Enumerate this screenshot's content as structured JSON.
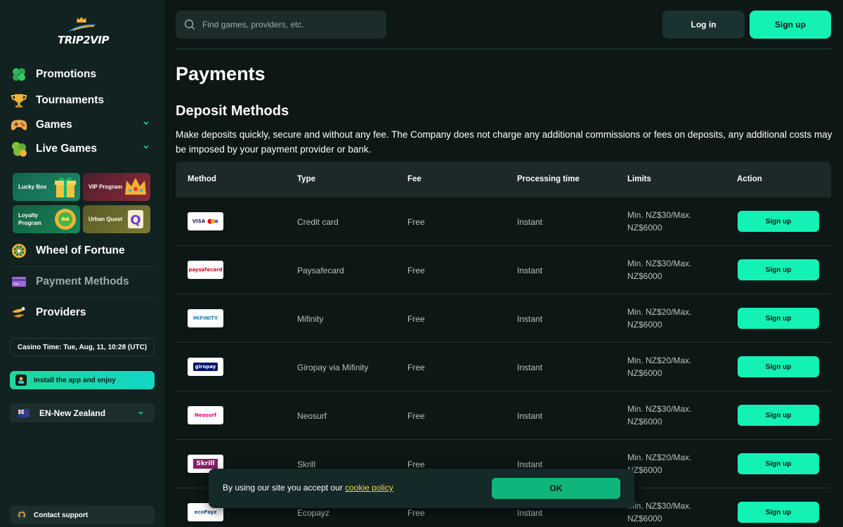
{
  "brand": {
    "logo_text": "TRIP2VIP"
  },
  "sidebar": {
    "nav": [
      {
        "label": "Promotions",
        "icon": "clover-icon"
      },
      {
        "label": "Tournaments",
        "icon": "trophy-icon"
      },
      {
        "label": "Games",
        "icon": "gamepad-icon"
      },
      {
        "label": "Live Games",
        "icon": "clover-live-icon"
      }
    ],
    "promos": [
      {
        "label": "Lucky Box",
        "icon": "gift-box-icon"
      },
      {
        "label": "VIP Program",
        "icon": "crown-icon"
      },
      {
        "label": "Loyalty Program",
        "icon": "loyalty-coin-icon"
      },
      {
        "label": "Urban Quest",
        "icon": "quest-scroll-icon"
      }
    ],
    "wheel": "Wheel of Fortune",
    "payment_methods": "Payment Methods",
    "providers": "Providers",
    "casino_time": "Casino Time: Tue, Aug, 11, 10:28 (UTC)",
    "install": "Install the app and enjoy",
    "language": "EN-New Zealand",
    "support": "Contact support"
  },
  "header": {
    "search_placeholder": "Find games, providers, etc.",
    "login": "Log in",
    "signup": "Sign up"
  },
  "main": {
    "title": "Payments",
    "section_title": "Deposit Methods",
    "description": "Make deposits quickly, secure and without any fee. The Company does not charge any additional commissions or fees on deposits, any additional costs may be imposed by your payment provider or bank.",
    "columns": [
      "Method",
      "Type",
      "Fee",
      "Processing time",
      "Limits",
      "Action"
    ],
    "rows": [
      {
        "logo": "VISA",
        "type": "Credit card",
        "fee": "Free",
        "time": "Instant",
        "limits": "Min. NZ$30/Max. NZ$6000",
        "action": "Sign up"
      },
      {
        "logo": "paysafecard",
        "type": "Paysafecard",
        "fee": "Free",
        "time": "Instant",
        "limits": "Min. NZ$30/Max. NZ$6000",
        "action": "Sign up"
      },
      {
        "logo": "MiFINITY",
        "type": "Mifinity",
        "fee": "Free",
        "time": "Instant",
        "limits": "Min. NZ$20/Max. NZ$6000",
        "action": "Sign up"
      },
      {
        "logo": "giropay",
        "type": "Giropay via Mifinity",
        "fee": "Free",
        "time": "Instant",
        "limits": "Min. NZ$20/Max. NZ$6000",
        "action": "Sign up"
      },
      {
        "logo": "Neosurf",
        "type": "Neosurf",
        "fee": "Free",
        "time": "Instant",
        "limits": "Min. NZ$30/Max. NZ$6000",
        "action": "Sign up"
      },
      {
        "logo": "Skrill",
        "type": "Skrill",
        "fee": "Free",
        "time": "Instant",
        "limits": "Min. NZ$20/Max. NZ$6000",
        "action": "Sign up"
      },
      {
        "logo": "ecoPayz",
        "type": "Ecopayz",
        "fee": "Free",
        "time": "Instant",
        "limits": "Min. NZ$30/Max. NZ$6000",
        "action": "Sign up"
      }
    ]
  },
  "cookie": {
    "message": "By using our site you accept our ",
    "link": "cookie policy",
    "ok": "OK"
  },
  "colors": {
    "accent": "#13f2b4",
    "background": "#0c1716",
    "sidebar": "#112220",
    "cookie_link": "#f7d23e"
  }
}
